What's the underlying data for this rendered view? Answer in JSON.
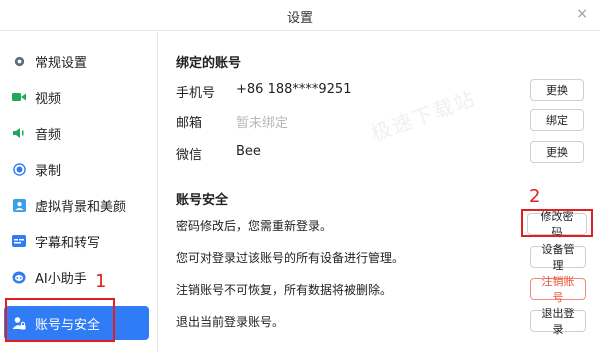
{
  "window": {
    "title": "设置",
    "close_glyph": "×"
  },
  "sidebar": {
    "items": [
      {
        "label": "常规设置",
        "icon": "gear-icon"
      },
      {
        "label": "视频",
        "icon": "video-icon"
      },
      {
        "label": "音频",
        "icon": "speaker-icon"
      },
      {
        "label": "录制",
        "icon": "record-icon"
      },
      {
        "label": "虚拟背景和美颜",
        "icon": "portrait-icon"
      },
      {
        "label": "字幕和转写",
        "icon": "caption-icon"
      },
      {
        "label": "AI小助手",
        "icon": "ai-assistant-icon"
      },
      {
        "label": "账号与安全",
        "icon": "account-lock-icon",
        "active": true
      }
    ]
  },
  "bound_accounts": {
    "title": "绑定的账号",
    "rows": [
      {
        "label": "手机号",
        "value": "+86 188****9251",
        "button": "更换"
      },
      {
        "label": "邮箱",
        "value": "暂未绑定",
        "button": "绑定"
      },
      {
        "label": "微信",
        "value": "Bee",
        "button": "更换"
      }
    ]
  },
  "security": {
    "title": "账号安全",
    "rows": [
      {
        "text": "密码修改后，您需重新登录。",
        "button": "修改密码"
      },
      {
        "text": "您可对登录过该账号的所有设备进行管理。",
        "button": "设备管理"
      },
      {
        "text": "注销账号不可恢复，所有数据将被删除。",
        "button": "注销账号"
      },
      {
        "text": "退出当前登录账号。",
        "button": "退出登录"
      }
    ]
  },
  "annotations": {
    "marker_1": "1",
    "marker_2": "2"
  },
  "watermark": "极速下载站",
  "colors": {
    "accent": "#2f7cf6",
    "danger": "#e8533a",
    "annotation": "#e02020"
  }
}
